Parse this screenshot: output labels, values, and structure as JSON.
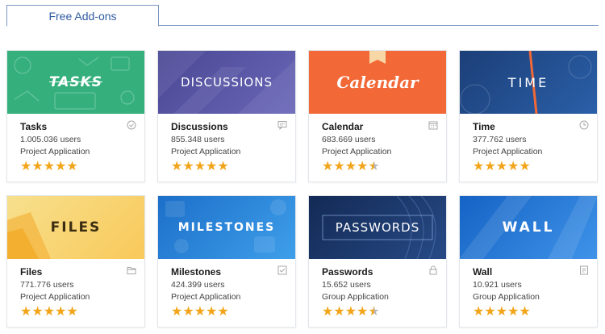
{
  "tabs": [
    {
      "label": "Free Add-ons"
    }
  ],
  "colors": {
    "star": "#f2a51a",
    "star_empty": "#b9b9b9",
    "tab_border": "#7a97c2",
    "tab_text": "#2f5aa0"
  },
  "cards": [
    {
      "banner": "TASKS",
      "name": "Tasks",
      "users": "1.005.036 users",
      "category": "Project Application",
      "rating": 5,
      "icon": "check-circle-icon",
      "color": "#35b07d"
    },
    {
      "banner": "DISCUSSIONS",
      "name": "Discussions",
      "users": "855.348 users",
      "category": "Project Application",
      "rating": 5,
      "icon": "comment-icon",
      "color": "#5551a6"
    },
    {
      "banner": "Calendar",
      "name": "Calendar",
      "users": "683.669 users",
      "category": "Project Application",
      "rating": 4.5,
      "icon": "calendar-icon",
      "color": "#f26836"
    },
    {
      "banner": "TIME",
      "name": "Time",
      "users": "377.762 users",
      "category": "Project Application",
      "rating": 5,
      "icon": "clock-icon",
      "color": "#1c3f78"
    },
    {
      "banner": "FILES",
      "name": "Files",
      "users": "771.776 users",
      "category": "Project Application",
      "rating": 5,
      "icon": "folder-icon",
      "color": "#f8d46f"
    },
    {
      "banner": "MILESTONES",
      "name": "Milestones",
      "users": "424.399 users",
      "category": "Project Application",
      "rating": 5,
      "icon": "checklist-icon",
      "color": "#1c6fc9"
    },
    {
      "banner": "PASSWORDS",
      "name": "Passwords",
      "users": "15.652 users",
      "category": "Group Application",
      "rating": 4.5,
      "icon": "lock-icon",
      "color": "#132a55"
    },
    {
      "banner": "WALL",
      "name": "Wall",
      "users": "10.921 users",
      "category": "Group Application",
      "rating": 5,
      "icon": "document-icon",
      "color": "#1563c5"
    }
  ]
}
